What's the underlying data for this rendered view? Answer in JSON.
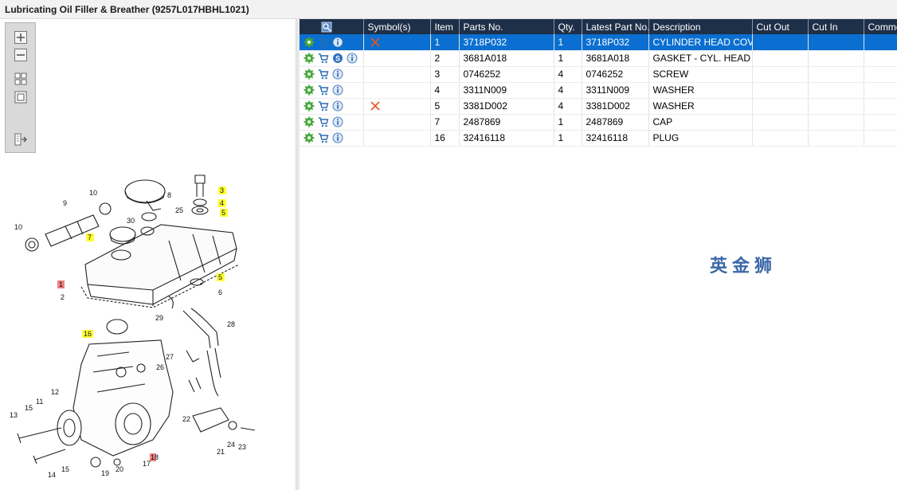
{
  "window": {
    "title": "Lubricating Oil Filler & Breather (9257L017HBHL1021)"
  },
  "toolbox": {
    "buttons": [
      "zoom-in-icon",
      "zoom-out-icon",
      "fit-grid-icon",
      "actual-size-icon",
      "export-icon"
    ]
  },
  "diagram": {
    "callouts": [
      {
        "n": "8"
      },
      {
        "n": "10"
      },
      {
        "n": "9"
      },
      {
        "n": "25"
      },
      {
        "n": "3"
      },
      {
        "n": "4"
      },
      {
        "n": "5"
      },
      {
        "n": "10"
      },
      {
        "n": "30"
      },
      {
        "n": "7"
      },
      {
        "n": "1"
      },
      {
        "n": "2"
      },
      {
        "n": "5"
      },
      {
        "n": "6"
      },
      {
        "n": "29"
      },
      {
        "n": "28"
      },
      {
        "n": "16"
      },
      {
        "n": "27"
      },
      {
        "n": "26"
      },
      {
        "n": "12"
      },
      {
        "n": "11"
      },
      {
        "n": "13"
      },
      {
        "n": "15"
      },
      {
        "n": "22"
      },
      {
        "n": "24"
      },
      {
        "n": "23"
      },
      {
        "n": "21"
      },
      {
        "n": "18"
      },
      {
        "n": "17"
      },
      {
        "n": "19"
      },
      {
        "n": "20"
      },
      {
        "n": "14"
      },
      {
        "n": "15"
      }
    ]
  },
  "table": {
    "columns": [
      "",
      "Symbol(s)",
      "Item",
      "Parts No.",
      "Qty.",
      "Latest Part No.",
      "Description",
      "Cut Out",
      "Cut In",
      "Comment"
    ],
    "rows": [
      {
        "item": "1",
        "part_no": "3718P032",
        "qty": "1",
        "latest": "3718P032",
        "description": "CYLINDER HEAD COVER",
        "cut_out": "",
        "cut_in": "",
        "comment": "",
        "symbol": "x",
        "service": false,
        "selected": true
      },
      {
        "item": "2",
        "part_no": "3681A018",
        "qty": "1",
        "latest": "3681A018",
        "description": "GASKET - CYL. HEAD COV",
        "cut_out": "",
        "cut_in": "",
        "comment": "",
        "symbol": "",
        "service": true,
        "selected": false
      },
      {
        "item": "3",
        "part_no": "0746252",
        "qty": "4",
        "latest": "0746252",
        "description": "SCREW",
        "cut_out": "",
        "cut_in": "",
        "comment": "",
        "symbol": "",
        "service": false,
        "selected": false
      },
      {
        "item": "4",
        "part_no": "3311N009",
        "qty": "4",
        "latest": "3311N009",
        "description": "WASHER",
        "cut_out": "",
        "cut_in": "",
        "comment": "",
        "symbol": "",
        "service": false,
        "selected": false
      },
      {
        "item": "5",
        "part_no": "3381D002",
        "qty": "4",
        "latest": "3381D002",
        "description": "WASHER",
        "cut_out": "",
        "cut_in": "",
        "comment": "",
        "symbol": "x",
        "service": false,
        "selected": false
      },
      {
        "item": "7",
        "part_no": "2487869",
        "qty": "1",
        "latest": "2487869",
        "description": "CAP",
        "cut_out": "",
        "cut_in": "",
        "comment": "",
        "symbol": "",
        "service": false,
        "selected": false
      },
      {
        "item": "16",
        "part_no": "32416118",
        "qty": "1",
        "latest": "32416118",
        "description": "PLUG",
        "cut_out": "",
        "cut_in": "",
        "comment": "",
        "symbol": "",
        "service": false,
        "selected": false
      }
    ]
  },
  "watermark": "英金狮",
  "colors": {
    "header_bg": "#1e2f48",
    "selected_row": "#0a6fd0",
    "highlight_yellow": "#ffff33",
    "highlight_red": "#f08080",
    "symbol_x": "#e2571e"
  }
}
